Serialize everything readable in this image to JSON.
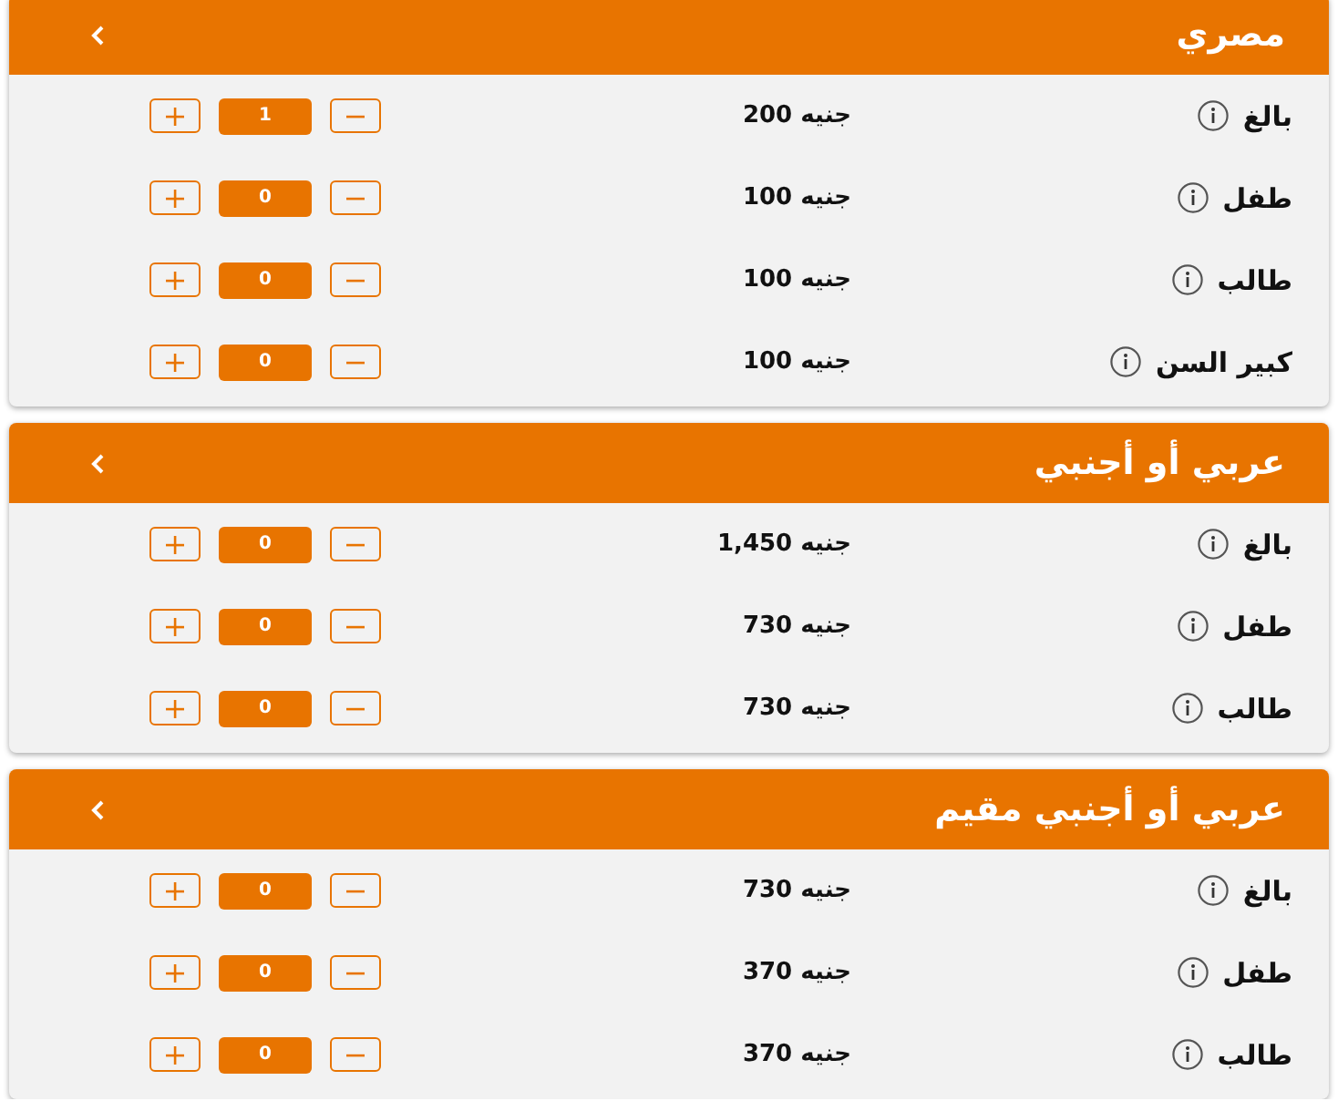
{
  "sections": [
    {
      "title": "مصري",
      "rows": [
        {
          "label": "بالغ",
          "price": "200 جنيه",
          "count": "1"
        },
        {
          "label": "طفل",
          "price": "100 جنيه",
          "count": "0"
        },
        {
          "label": "طالب",
          "price": "100 جنيه",
          "count": "0"
        },
        {
          "label": "كبير السن",
          "price": "100 جنيه",
          "count": "0"
        }
      ]
    },
    {
      "title": "عربي أو أجنبي",
      "rows": [
        {
          "label": "بالغ",
          "price": "1,450 جنيه",
          "count": "0"
        },
        {
          "label": "طفل",
          "price": "730 جنيه",
          "count": "0"
        },
        {
          "label": "طالب",
          "price": "730 جنيه",
          "count": "0"
        }
      ]
    },
    {
      "title": "عربي أو أجنبي مقيم",
      "rows": [
        {
          "label": "بالغ",
          "price": "730 جنيه",
          "count": "0"
        },
        {
          "label": "طفل",
          "price": "370 جنيه",
          "count": "0"
        },
        {
          "label": "طالب",
          "price": "370 جنيه",
          "count": "0"
        }
      ]
    }
  ]
}
